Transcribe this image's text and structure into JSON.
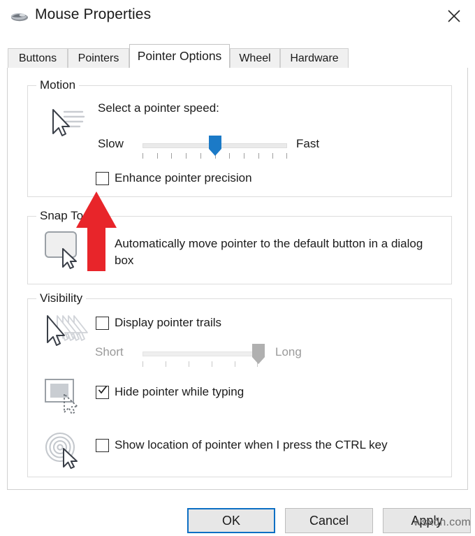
{
  "window": {
    "title": "Mouse Properties",
    "icon": "mouse-device-icon",
    "close_label": "✕"
  },
  "tabs": [
    {
      "label": "Buttons",
      "active": false
    },
    {
      "label": "Pointers",
      "active": false
    },
    {
      "label": "Pointer Options",
      "active": true
    },
    {
      "label": "Wheel",
      "active": false
    },
    {
      "label": "Hardware",
      "active": false
    }
  ],
  "motion": {
    "group_label": "Motion",
    "icon": "pointer-speed-icon",
    "speed_caption": "Select a pointer speed:",
    "slow_label": "Slow",
    "fast_label": "Fast",
    "slider": {
      "value": 6,
      "min": 1,
      "max": 11,
      "ticks": 11,
      "thumb_color": "#1b7ac7",
      "enabled": true
    },
    "enhance_precision": {
      "label": "Enhance pointer precision",
      "checked": false
    }
  },
  "snap_to": {
    "group_label": "Snap To",
    "icon": "default-button-icon",
    "auto_move": {
      "label": "Automatically move pointer to the default button in a dialog box",
      "checked": false
    }
  },
  "visibility": {
    "group_label": "Visibility",
    "trails": {
      "icon": "pointer-trails-icon",
      "label": "Display pointer trails",
      "checked": false,
      "short_label": "Short",
      "long_label": "Long",
      "slider": {
        "value": 6,
        "min": 1,
        "max": 6,
        "ticks": 6,
        "thumb_color": "#b0b0b0",
        "enabled": false
      }
    },
    "hide_typing": {
      "icon": "hide-pointer-icon",
      "label": "Hide pointer while typing",
      "checked": true
    },
    "show_location": {
      "icon": "ctrl-locate-icon",
      "label": "Show location of pointer when I press the CTRL key",
      "checked": false
    }
  },
  "buttons": {
    "ok": "OK",
    "cancel": "Cancel",
    "apply": "Apply",
    "default_focus": "ok"
  },
  "watermark": "wsxdn.com"
}
